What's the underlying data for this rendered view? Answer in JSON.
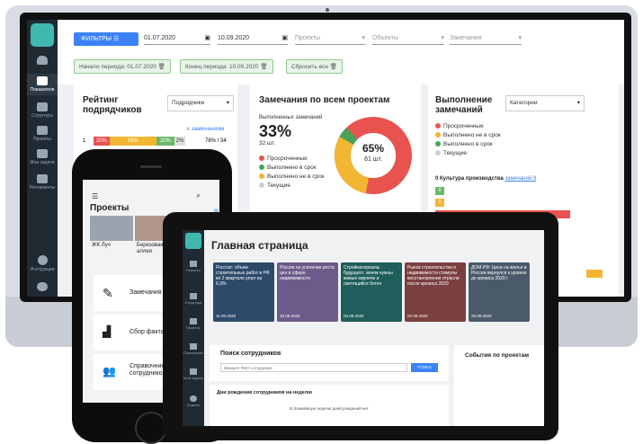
{
  "desktop": {
    "sidebar": [
      {
        "label": "",
        "icon": "bell-icon"
      },
      {
        "label": "Показатели",
        "icon": "bar-chart-icon",
        "active": true
      },
      {
        "label": "Структура",
        "icon": "structure-icon"
      },
      {
        "label": "Проекты",
        "icon": "projects-icon"
      },
      {
        "label": "Мои задачи",
        "icon": "tasks-icon"
      },
      {
        "label": "Регламенты",
        "icon": "document-icon"
      },
      {
        "label": "Инструкции",
        "icon": "help-icon"
      },
      {
        "label": "",
        "icon": "gear-icon"
      }
    ],
    "filter_button": "ФИЛЬТРЫ",
    "date_from": "01.07.2020",
    "date_to": "10.09.2020",
    "projects_placeholder": "Проекты",
    "objects_placeholder": "Объекты",
    "remarks_placeholder": "Замечания",
    "chip_start": "Начало периода: 01.07.2020",
    "chip_end": "Конец периода: 10.09.2020",
    "reset_all": "Сбросить все",
    "rating": {
      "title": "Рейтинг подрядчиков",
      "select": "Подрядчики",
      "link": "к замечаниям",
      "row_index": "1",
      "seg1": "20%",
      "seg2": "58%",
      "seg3": "20%",
      "seg4": "2%",
      "summary": "78% / 34"
    },
    "remarks": {
      "title": "Замечания по всем проектам",
      "done_label": "Выполненных замечаний",
      "percent": "33%",
      "count": "32 шт.",
      "donut_percent": "65%",
      "donut_count": "61 шт.",
      "legend": [
        {
          "label": "Просроченные",
          "color": "#e8534f"
        },
        {
          "label": "Выполнено в срок",
          "color": "#4aa25a"
        },
        {
          "label": "Выполнено не в срок",
          "color": "#f2b632"
        },
        {
          "label": "Текущие",
          "color": "#d0d0d0"
        }
      ]
    },
    "execution": {
      "title": "Выполнение замечаний",
      "select": "Категории",
      "legend": [
        {
          "label": "Просроченные",
          "color": "#e8534f"
        },
        {
          "label": "Выполнено не в срок",
          "color": "#f2b632"
        },
        {
          "label": "Выполнено в срок",
          "color": "#4aa25a"
        },
        {
          "label": "Текущие",
          "color": "#d0d0d0"
        }
      ],
      "culture": "0 Культура производства",
      "culture_link": "замечаний 9",
      "bar1": "0",
      "bar2": "0"
    }
  },
  "phone": {
    "title": "Проекты",
    "project1": "ЖК Луч",
    "project2": "Березовая аллея",
    "tiles": [
      "Замечания",
      "Сбор факта",
      "Справочник сотрудников"
    ],
    "peek1": "м",
    "peek2": "/ 11"
  },
  "tablet": {
    "sidebar": [
      {
        "label": "Новости",
        "icon": "news-icon"
      },
      {
        "label": "Структура",
        "icon": "structure-icon"
      },
      {
        "label": "Проекты",
        "icon": "projects-icon"
      },
      {
        "label": "Показатели",
        "icon": "chart-icon"
      },
      {
        "label": "Мои задачи",
        "icon": "tasks-icon"
      },
      {
        "label": "Отделы",
        "icon": "pie-icon"
      }
    ],
    "page_title": "Главная страница",
    "news": [
      {
        "title": "Росстат: объем строительных работ в РФ во 2 квартале упал на 6,3%",
        "date": "11.09.2020",
        "color": "#2d4a6b"
      },
      {
        "title": "Россия на усиление роста цен в сфере недвижимости",
        "date": "10.09.2020",
        "color": "#6b5a8a"
      },
      {
        "title": "Стройматериалы будущего: зачем нужны живые кирпичи и светящийся бетон",
        "date": "04.09.2020",
        "color": "#1f5e5a"
      },
      {
        "title": "Рынок строительства и недвижимости стимулы восстановления отрасли после кризиса 2020",
        "date": "02.09.2020",
        "color": "#7a3f3f"
      },
      {
        "title": "ДОМ.РФ: Цена на жилье в России вернулся к уровню до кризиса 2020 г",
        "date": "25.08.2020",
        "color": "#4a5a6b"
      }
    ],
    "search_title": "Поиск сотрудников",
    "search_placeholder": "Введите ФИО сотрудника",
    "search_button": "ПОИСК",
    "events_title": "События по проектам",
    "birthdays_title": "Дни рождения сотрудников на неделю",
    "birthdays_empty": "В ближайшую неделю дней рождений нет"
  }
}
